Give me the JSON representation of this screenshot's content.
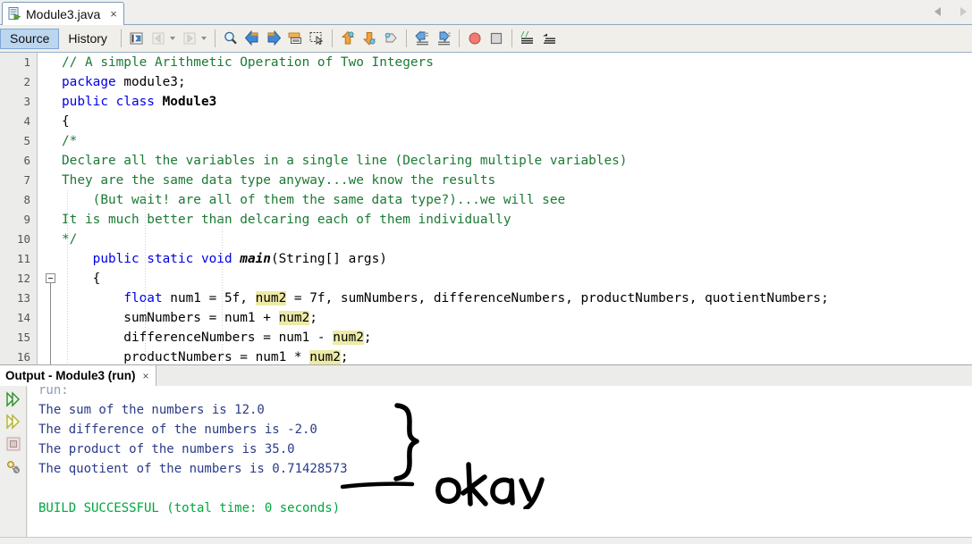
{
  "window": {
    "editor_tab": {
      "title": "Module3.java",
      "close": "×",
      "icon": "java-file-icon"
    },
    "scroll_left": "scroll-left-arrow",
    "scroll_right": "scroll-right-arrow"
  },
  "toolbar": {
    "views": [
      {
        "label": "Source",
        "active": true
      },
      {
        "label": "History",
        "active": false
      }
    ],
    "icons": [
      {
        "name": "toggle-bookmark-icon"
      },
      {
        "name": "previous-bookmark-icon",
        "disabled": true,
        "caret": true
      },
      {
        "name": "next-bookmark-icon",
        "disabled": true,
        "caret": true
      },
      {
        "name": "find-selection-icon"
      },
      {
        "name": "find-previous-icon"
      },
      {
        "name": "find-next-icon"
      },
      {
        "name": "toggle-highlight-search-icon"
      },
      {
        "name": "toggle-rectangular-selection-icon"
      },
      {
        "name": "previous-error-icon"
      },
      {
        "name": "next-error-icon"
      },
      {
        "name": "shift-line-left-icon"
      },
      {
        "name": "shift-line-right-icon"
      },
      {
        "name": "start-macro-recording-icon"
      },
      {
        "name": "stop-macro-recording-icon"
      },
      {
        "name": "comment-icon"
      },
      {
        "name": "uncomment-icon"
      }
    ]
  },
  "editor": {
    "lines": [
      {
        "n": "1",
        "indent": 0,
        "fold": false,
        "segments": [
          {
            "t": "// A simple Arithmetic Operation of Two Integers",
            "c": "c-comment"
          }
        ]
      },
      {
        "n": "2",
        "indent": 0,
        "fold": false,
        "segments": [
          {
            "t": "package ",
            "c": "c-kw"
          },
          {
            "t": "module3;",
            "c": ""
          }
        ]
      },
      {
        "n": "3",
        "indent": 0,
        "fold": false,
        "segments": [
          {
            "t": "public class ",
            "c": "c-kw"
          },
          {
            "t": "Module3",
            "c": "c-cls"
          }
        ]
      },
      {
        "n": "4",
        "indent": 0,
        "fold": false,
        "segments": [
          {
            "t": "{",
            "c": ""
          }
        ]
      },
      {
        "n": "5",
        "indent": 0,
        "fold": false,
        "segments": [
          {
            "t": "/*",
            "c": "c-comment"
          }
        ]
      },
      {
        "n": "6",
        "indent": 0,
        "fold": false,
        "segments": [
          {
            "t": "Declare all the variables in a single line (Declaring multiple variables)",
            "c": "c-comment"
          }
        ]
      },
      {
        "n": "7",
        "indent": 0,
        "fold": false,
        "segments": [
          {
            "t": "They are the same data type anyway...we know the results",
            "c": "c-comment"
          }
        ]
      },
      {
        "n": "8",
        "indent": 0,
        "fold": false,
        "segments": [
          {
            "t": "    (But wait! are all of them the same data type?)...we will see",
            "c": "c-comment"
          }
        ]
      },
      {
        "n": "9",
        "indent": 0,
        "fold": false,
        "segments": [
          {
            "t": "It is much better than delcaring each of them individually",
            "c": "c-comment"
          }
        ]
      },
      {
        "n": "10",
        "indent": 0,
        "fold": false,
        "segments": [
          {
            "t": "*/",
            "c": "c-comment"
          }
        ]
      },
      {
        "n": "11",
        "indent": 0,
        "fold": false,
        "segments": [
          {
            "t": "    ",
            "c": ""
          },
          {
            "t": "public static void ",
            "c": "c-kw"
          },
          {
            "t": "main",
            "c": "c-mth"
          },
          {
            "t": "(String[] args)",
            "c": ""
          }
        ]
      },
      {
        "n": "12",
        "indent": 0,
        "fold": true,
        "segments": [
          {
            "t": "    {",
            "c": ""
          }
        ]
      },
      {
        "n": "13",
        "indent": 0,
        "fold": false,
        "segments": [
          {
            "t": "        ",
            "c": ""
          },
          {
            "t": "float",
            "c": "c-kw"
          },
          {
            "t": " num1 = 5f, ",
            "c": ""
          },
          {
            "t": "num2",
            "c": "hl"
          },
          {
            "t": " = 7f, sumNumbers, differenceNumbers, productNumbers, quotientNumbers;",
            "c": ""
          }
        ]
      },
      {
        "n": "14",
        "indent": 0,
        "fold": false,
        "segments": [
          {
            "t": "        sumNumbers = num1 + ",
            "c": ""
          },
          {
            "t": "num2",
            "c": "hl"
          },
          {
            "t": ";",
            "c": ""
          }
        ]
      },
      {
        "n": "15",
        "indent": 0,
        "fold": false,
        "segments": [
          {
            "t": "        differenceNumbers = num1 - ",
            "c": ""
          },
          {
            "t": "num2",
            "c": "hl"
          },
          {
            "t": ";",
            "c": ""
          }
        ]
      },
      {
        "n": "16",
        "indent": 0,
        "fold": false,
        "segments": [
          {
            "t": "        productNumbers = num1 * ",
            "c": ""
          },
          {
            "t": "num2",
            "c": "hl"
          },
          {
            "t": ";",
            "c": ""
          }
        ]
      }
    ]
  },
  "output": {
    "tab": {
      "title": "Output - Module3 (run)",
      "close": "×"
    },
    "gutter_icons": [
      {
        "name": "rerun-icon"
      },
      {
        "name": "rerun-with-different-params-icon"
      },
      {
        "name": "stop-process-icon"
      },
      {
        "name": "settings-gear-icon"
      }
    ],
    "lines": [
      {
        "t": "run:",
        "c": "out-gray"
      },
      {
        "t": "The sum of the numbers is 12.0",
        "c": "out-blue"
      },
      {
        "t": "The difference of the numbers is -2.0",
        "c": "out-blue"
      },
      {
        "t": "The product of the numbers is 35.0",
        "c": "out-blue"
      },
      {
        "t": "The quotient of the numbers is 0.71428573",
        "c": "out-blue"
      },
      {
        "t": "",
        "c": "out-blue"
      },
      {
        "t": "BUILD SUCCESSFUL (total time: 0 seconds)",
        "c": "out-green"
      }
    ]
  },
  "annotations": {
    "handwritten_text": "okay",
    "brace": "curly-brace-bracket",
    "underline": "underline-stroke",
    "ink_color": "#000000"
  },
  "colors": {
    "comment_green": "#1b7a34",
    "keyword_blue": "#0000e6",
    "highlight_yellow": "#edeaa8",
    "output_blue": "#2b3a87",
    "output_green": "#00a63f",
    "tab_active": "#bcd6f0"
  }
}
